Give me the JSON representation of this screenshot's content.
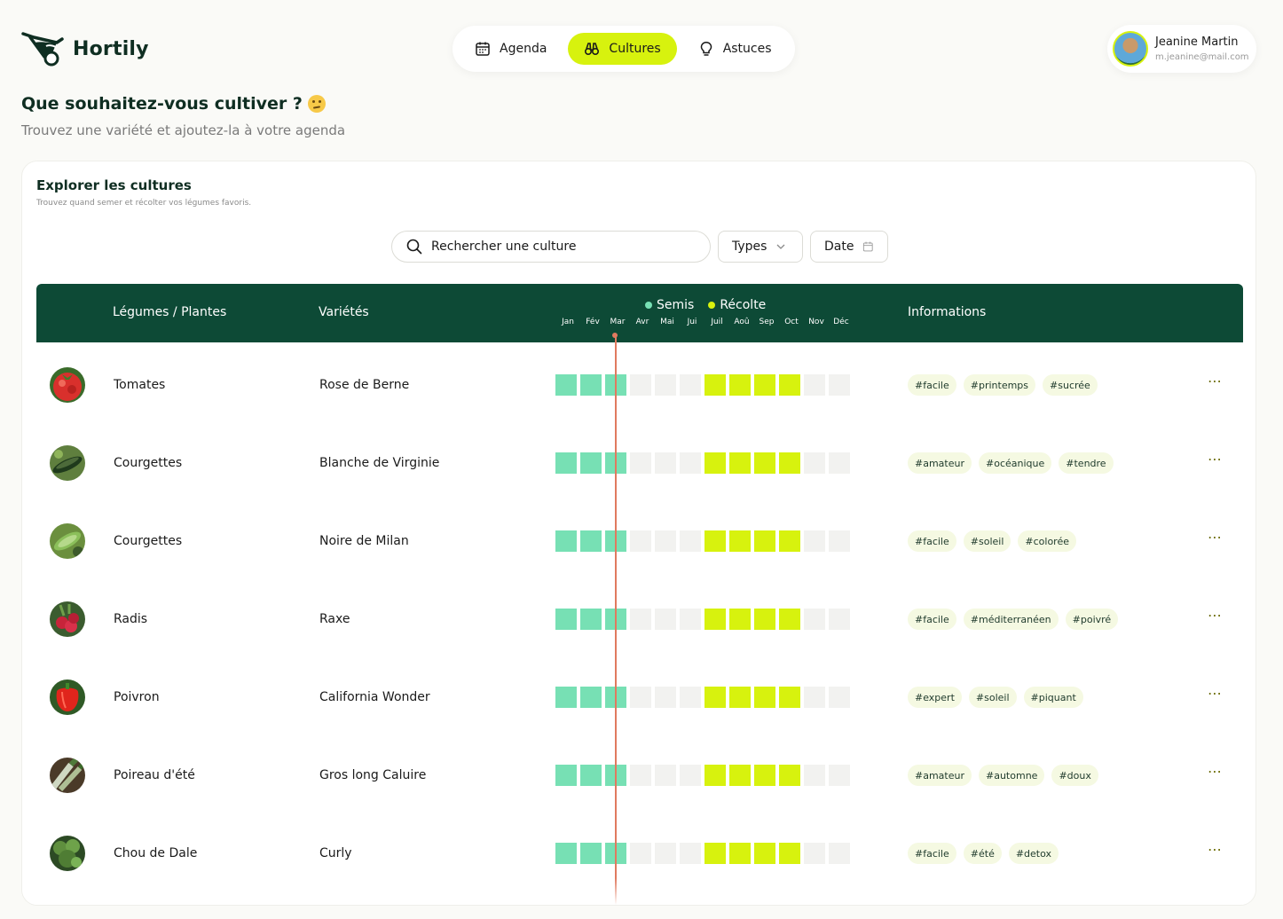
{
  "brand": {
    "name": "Hortily"
  },
  "nav": {
    "items": [
      {
        "label": "Agenda",
        "icon": "calendar-icon",
        "active": false
      },
      {
        "label": "Cultures",
        "icon": "binoculars-icon",
        "active": true
      },
      {
        "label": "Astuces",
        "icon": "lightbulb-icon",
        "active": false
      }
    ]
  },
  "user": {
    "name": "Jeanine Martin",
    "email": "m.jeanine@mail.com"
  },
  "page": {
    "title": "Que souhaitez-vous cultiver ?",
    "subtitle": "Trouvez une variété et ajoutez-la à votre agenda"
  },
  "explorer": {
    "title": "Explorer les cultures",
    "subtitle": "Trouvez quand semer et récolter vos légumes favoris.",
    "search_placeholder": "Rechercher une culture",
    "filter_types": "Types",
    "filter_date": "Date"
  },
  "table": {
    "columns": {
      "plant": "Légumes / Plantes",
      "variety": "Variétés",
      "info": "Informations"
    },
    "legend": {
      "sowing": "Semis",
      "harvest": "Récolte"
    },
    "months": [
      "Jan",
      "Fév",
      "Mar",
      "Avr",
      "Mai",
      "Jui",
      "Juil",
      "Aoû",
      "Sep",
      "Oct",
      "Nov",
      "Déc"
    ],
    "colors": {
      "sowing": "#77e0b4",
      "harvest": "#d7f20e",
      "empty": "#f2f2f0",
      "header": "#0d4a36"
    },
    "current_month": "Mar",
    "rows": [
      {
        "plant": "Tomates",
        "variety": "Rose de Berne",
        "thumb": "tomato",
        "calendar": [
          "s",
          "s",
          "s",
          "-",
          "-",
          "-",
          "r",
          "r",
          "r",
          "r",
          "-",
          "-"
        ],
        "tags": [
          "#facile",
          "#printemps",
          "#sucrée"
        ]
      },
      {
        "plant": "Courgettes",
        "variety": "Blanche de Virginie",
        "thumb": "zucchini",
        "calendar": [
          "s",
          "s",
          "s",
          "-",
          "-",
          "-",
          "r",
          "r",
          "r",
          "r",
          "-",
          "-"
        ],
        "tags": [
          "#amateur",
          "#océanique",
          "#tendre"
        ]
      },
      {
        "plant": "Courgettes",
        "variety": "Noire de Milan",
        "thumb": "zucchini-plant",
        "calendar": [
          "s",
          "s",
          "s",
          "-",
          "-",
          "-",
          "r",
          "r",
          "r",
          "r",
          "-",
          "-"
        ],
        "tags": [
          "#facile",
          "#soleil",
          "#colorée"
        ]
      },
      {
        "plant": "Radis",
        "variety": "Raxe",
        "thumb": "radish",
        "calendar": [
          "s",
          "s",
          "s",
          "-",
          "-",
          "-",
          "r",
          "r",
          "r",
          "r",
          "-",
          "-"
        ],
        "tags": [
          "#facile",
          "#méditerranéen",
          "#poivré"
        ]
      },
      {
        "plant": "Poivron",
        "variety": "California Wonder",
        "thumb": "pepper",
        "calendar": [
          "s",
          "s",
          "s",
          "-",
          "-",
          "-",
          "r",
          "r",
          "r",
          "r",
          "-",
          "-"
        ],
        "tags": [
          "#expert",
          "#soleil",
          "#piquant"
        ]
      },
      {
        "plant": "Poireau d'été",
        "variety": "Gros long Caluire",
        "thumb": "leek",
        "calendar": [
          "s",
          "s",
          "s",
          "-",
          "-",
          "-",
          "r",
          "r",
          "r",
          "r",
          "-",
          "-"
        ],
        "tags": [
          "#amateur",
          "#automne",
          "#doux"
        ]
      },
      {
        "plant": "Chou de Dale",
        "variety": "Curly",
        "thumb": "kale",
        "calendar": [
          "s",
          "s",
          "s",
          "-",
          "-",
          "-",
          "r",
          "r",
          "r",
          "r",
          "-",
          "-"
        ],
        "tags": [
          "#facile",
          "#été",
          "#detox"
        ]
      }
    ]
  }
}
